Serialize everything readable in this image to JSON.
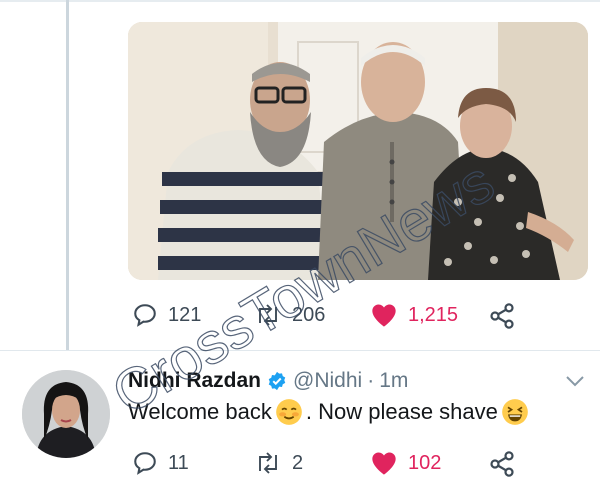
{
  "tweet": {
    "actions": {
      "replies": "121",
      "retweets": "206",
      "likes": "1,215"
    }
  },
  "reply": {
    "name": "Nidhi Razdan",
    "handle": "@Nidhi",
    "separator": "·",
    "time": "1m",
    "text_part1": "Welcome back",
    "text_part2": ". Now please shave",
    "actions": {
      "replies": "11",
      "retweets": "2",
      "likes": "102"
    }
  },
  "watermark": "CrossTownNews",
  "colors": {
    "like": "#e0245e",
    "verified": "#1da1f2",
    "muted": "#657786",
    "thread_line": "#ccd6dd"
  },
  "icons": [
    "reply-icon",
    "retweet-icon",
    "heart-icon",
    "share-icon",
    "verified-badge-icon",
    "chevron-down-icon"
  ]
}
